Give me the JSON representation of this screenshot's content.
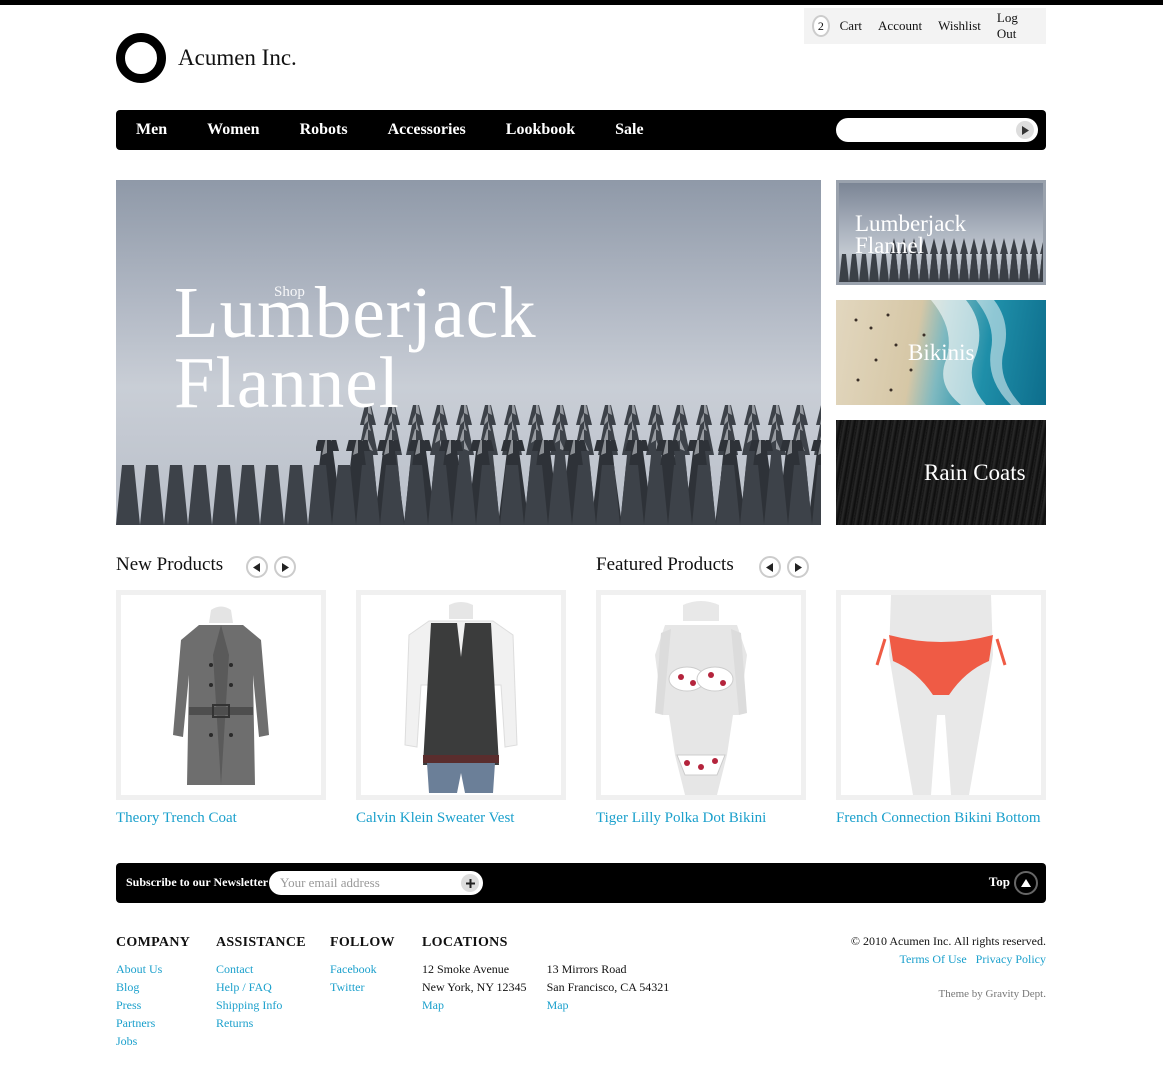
{
  "utility": {
    "cart_count": "2",
    "links": [
      "Cart",
      "Account",
      "Wishlist",
      "Log Out"
    ]
  },
  "logo": {
    "name": "Acumen Inc."
  },
  "nav": {
    "items": [
      "Men",
      "Women",
      "Robots",
      "Accessories",
      "Lookbook",
      "Sale"
    ],
    "search_value": ""
  },
  "hero": {
    "kicker": "Shop",
    "headline_line1": "Lumberjack",
    "headline_line2": "Flannel"
  },
  "promos": [
    {
      "label_line1": "Lumberjack",
      "label_line2": "Flannel"
    },
    {
      "label_line1": "Bikinis",
      "label_line2": ""
    },
    {
      "label_line1": "Rain Coats",
      "label_line2": ""
    }
  ],
  "sections": {
    "new_products": "New Products",
    "featured_products": "Featured Products"
  },
  "products": [
    {
      "name": "Theory Trench Coat"
    },
    {
      "name": "Calvin Klein Sweater Vest"
    },
    {
      "name": "Tiger Lilly Polka Dot Bikini"
    },
    {
      "name": "French Connection Bikini Bottom"
    }
  ],
  "newsletter": {
    "label": "Subscribe to our Newsletter",
    "placeholder": "Your email address",
    "top_label": "Top"
  },
  "footer": {
    "company": {
      "heading": "COMPANY",
      "links": [
        "About Us",
        "Blog",
        "Press",
        "Partners",
        "Jobs"
      ]
    },
    "assistance": {
      "heading": "ASSISTANCE",
      "links": [
        "Contact",
        "Help / FAQ",
        "Shipping Info",
        "Returns"
      ]
    },
    "follow": {
      "heading": "FOLLOW",
      "links": [
        "Facebook",
        "Twitter"
      ]
    },
    "locations": {
      "heading": "LOCATIONS",
      "items": [
        {
          "line1": "12 Smoke Avenue",
          "line2": "New York, NY 12345",
          "map": "Map"
        },
        {
          "line1": "13 Mirrors Road",
          "line2": "San Francisco, CA 54321",
          "map": "Map"
        }
      ]
    },
    "copyright": "© 2010 Acumen Inc. All rights reserved.",
    "legal_links": [
      "Terms Of Use",
      "Privacy Policy"
    ],
    "credit": "Theme by Gravity Dept."
  },
  "colors": {
    "link": "#1ba0cc",
    "bar": "#000000"
  }
}
